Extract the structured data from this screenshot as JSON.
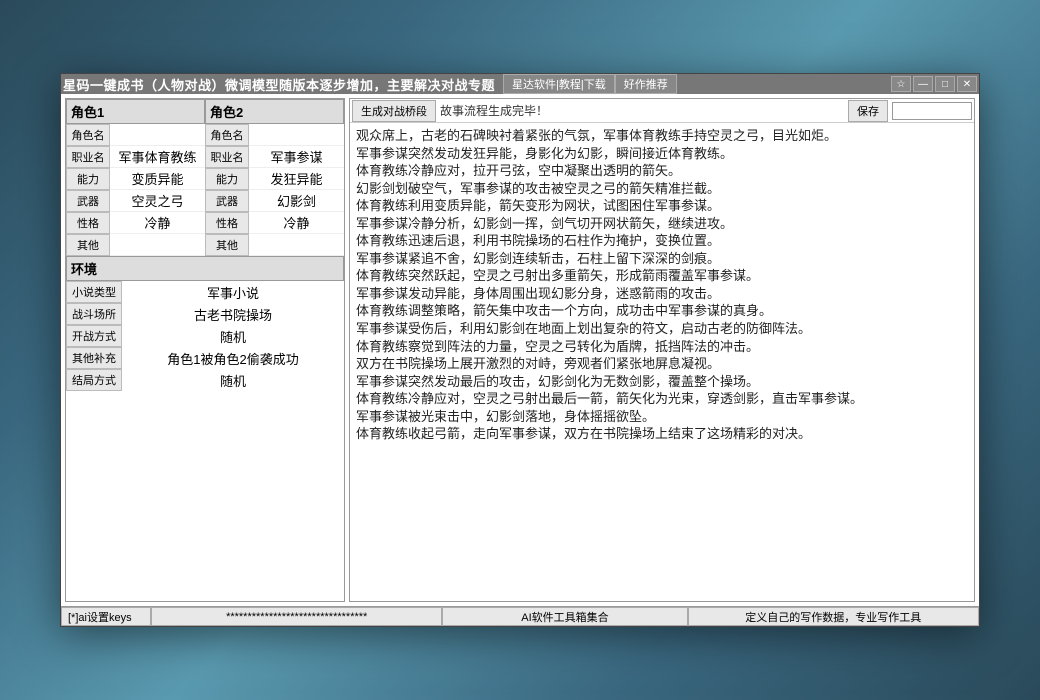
{
  "titlebar": {
    "title": "星码一键成书（人物对战）微调模型随版本逐步增加，主要解决对战专题",
    "links": [
      "星达软件|教程|下载",
      "好作推荐"
    ],
    "winbtns": {
      "star": "☆",
      "min": "—",
      "max": "□",
      "close": "✕"
    }
  },
  "left": {
    "char1_header": "角色1",
    "char2_header": "角色2",
    "labels": {
      "name": "角色名",
      "job": "职业名",
      "ability": "能力",
      "weapon": "武器",
      "trait": "性格",
      "other": "其他"
    },
    "char1": {
      "name": "",
      "job": "军事体育教练",
      "ability": "变质异能",
      "weapon": "空灵之弓",
      "trait": "冷静",
      "other": ""
    },
    "char2": {
      "name": "",
      "job": "军事参谋",
      "ability": "发狂异能",
      "weapon": "幻影剑",
      "trait": "冷静",
      "other": ""
    },
    "env_header": "环境",
    "env_labels": {
      "genre": "小说类型",
      "place": "战斗场所",
      "start": "开战方式",
      "extra": "其他补充",
      "end": "结局方式"
    },
    "env": {
      "genre": "军事小说",
      "place": "古老书院操场",
      "start": "随机",
      "extra": "角色1被角色2偷袭成功",
      "end": "随机"
    }
  },
  "right": {
    "generate_btn": "生成对战桥段",
    "status": "故事流程生成完毕！",
    "save_btn": "保存",
    "story_lines": [
      "观众席上，古老的石碑映衬着紧张的气氛，军事体育教练手持空灵之弓，目光如炬。",
      "军事参谋突然发动发狂异能，身影化为幻影，瞬间接近体育教练。",
      "体育教练冷静应对，拉开弓弦，空中凝聚出透明的箭矢。",
      "幻影剑划破空气，军事参谋的攻击被空灵之弓的箭矢精准拦截。",
      "体育教练利用变质异能，箭矢变形为网状，试图困住军事参谋。",
      "军事参谋冷静分析，幻影剑一挥，剑气切开网状箭矢，继续进攻。",
      "体育教练迅速后退，利用书院操场的石柱作为掩护，变换位置。",
      "军事参谋紧追不舍，幻影剑连续斩击，石柱上留下深深的剑痕。",
      "体育教练突然跃起，空灵之弓射出多重箭矢，形成箭雨覆盖军事参谋。",
      "军事参谋发动异能，身体周围出现幻影分身，迷惑箭雨的攻击。",
      "体育教练调整策略，箭矢集中攻击一个方向，成功击中军事参谋的真身。",
      "军事参谋受伤后，利用幻影剑在地面上划出复杂的符文，启动古老的防御阵法。",
      "体育教练察觉到阵法的力量，空灵之弓转化为盾牌，抵挡阵法的冲击。",
      "双方在书院操场上展开激烈的对峙，旁观者们紧张地屏息凝视。",
      "军事参谋突然发动最后的攻击，幻影剑化为无数剑影，覆盖整个操场。",
      "体育教练冷静应对，空灵之弓射出最后一箭，箭矢化为光束，穿透剑影，直击军事参谋。",
      "军事参谋被光束击中，幻影剑落地，身体摇摇欲坠。",
      "体育教练收起弓箭，走向军事参谋，双方在书院操场上结束了这场精彩的对决。"
    ]
  },
  "footer": {
    "a": "[*]ai设置keys",
    "b": "*********************************",
    "c": "AI软件工具箱集合",
    "d": "定义自己的写作数据，专业写作工具"
  }
}
